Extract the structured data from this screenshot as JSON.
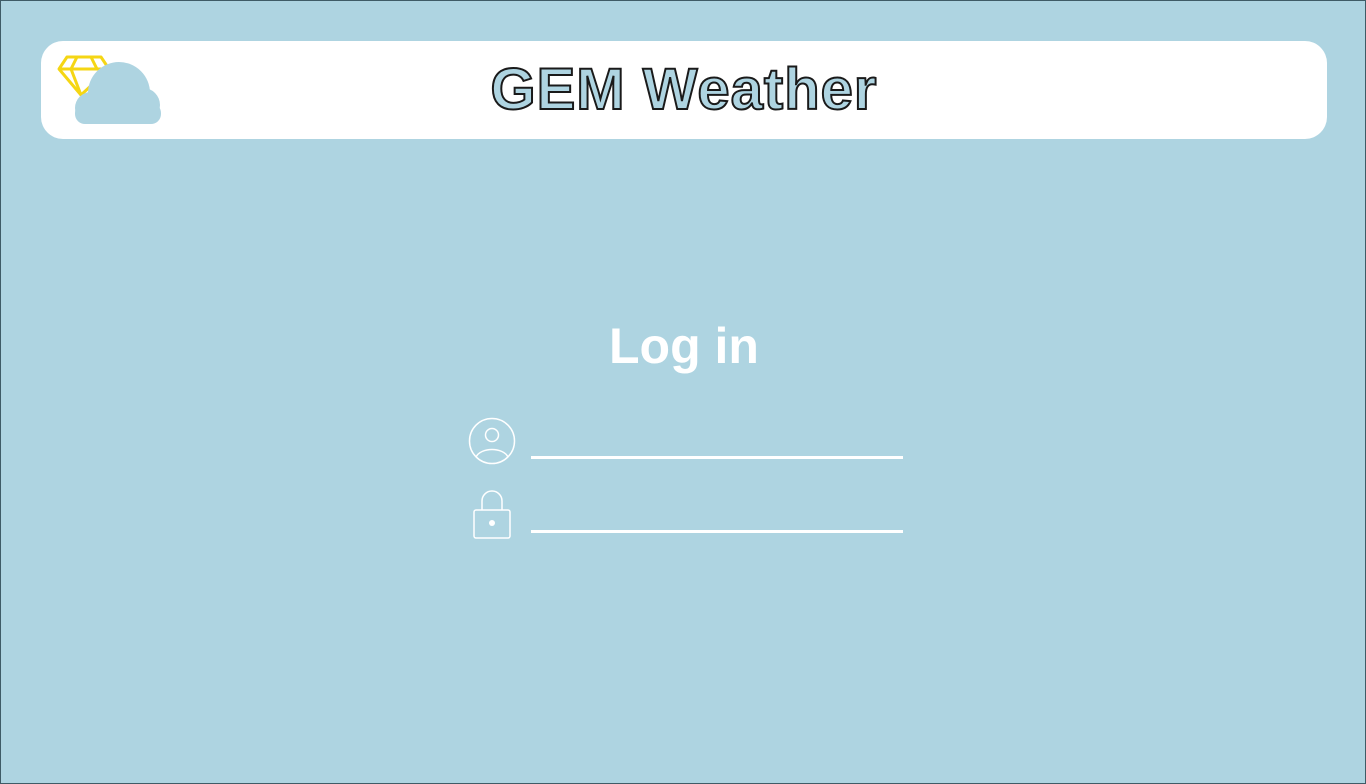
{
  "header": {
    "app_title": "GEM Weather",
    "logo_icon": "gem-cloud-logo-icon"
  },
  "login": {
    "title": "Log in",
    "username": {
      "icon": "user-circle-icon",
      "value": "",
      "placeholder": ""
    },
    "password": {
      "icon": "padlock-icon",
      "value": "",
      "placeholder": ""
    }
  },
  "colors": {
    "background": "#AED4E1",
    "header_bg": "#FFFFFF",
    "gem_yellow": "#F5D614",
    "text_white": "#FFFFFF",
    "title_outline": "#1A1A1A"
  }
}
